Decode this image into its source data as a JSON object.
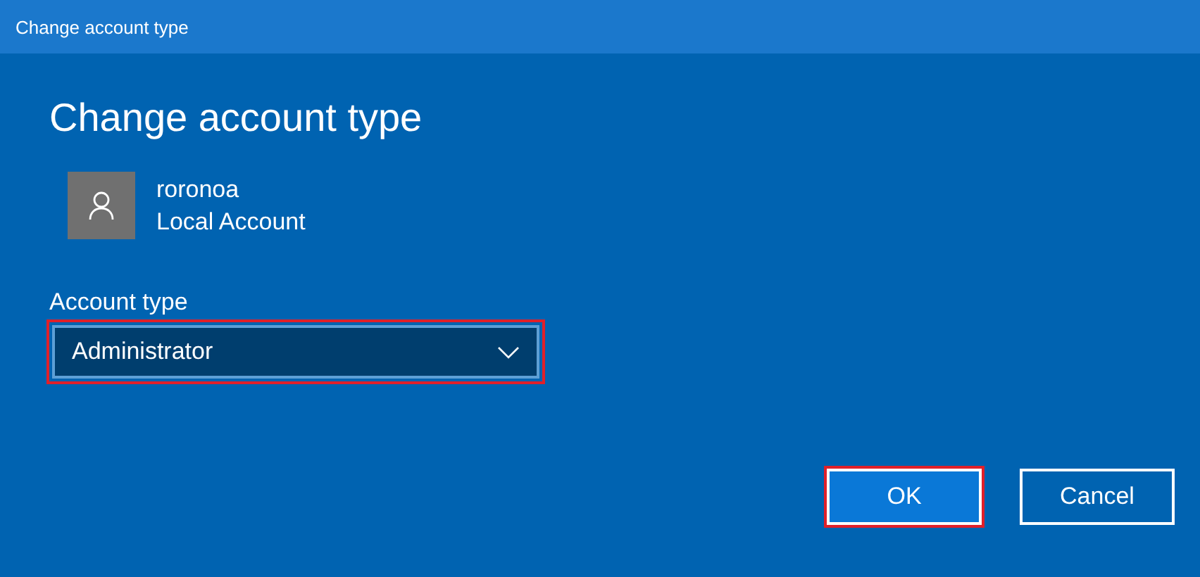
{
  "window": {
    "title": "Change account type"
  },
  "heading": "Change account type",
  "account": {
    "name": "roronoa",
    "type": "Local Account"
  },
  "account_type": {
    "label": "Account type",
    "value": "Administrator",
    "highlighted": true
  },
  "buttons": [
    {
      "label": "OK",
      "kind": "primary",
      "highlighted": true
    },
    {
      "label": "Cancel",
      "kind": "secondary",
      "highlighted": false
    }
  ]
}
